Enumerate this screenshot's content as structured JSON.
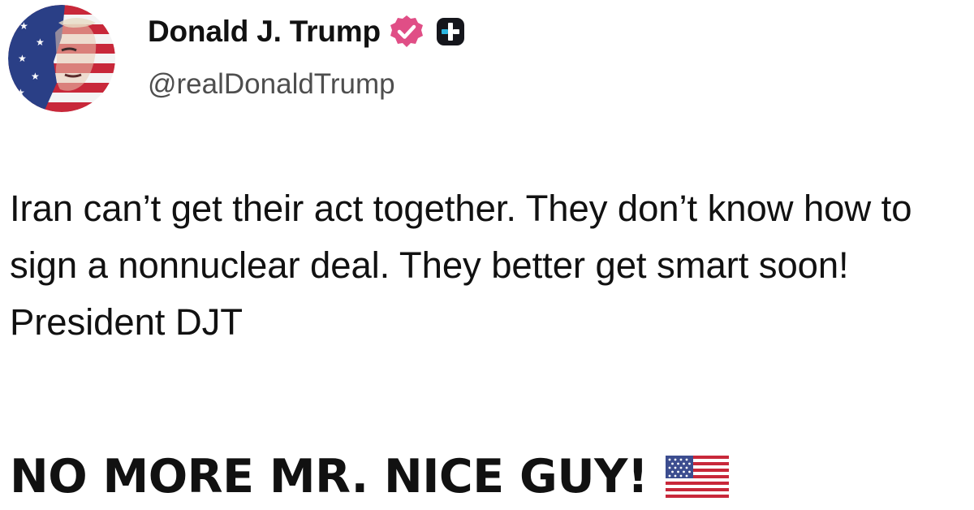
{
  "post": {
    "author": {
      "display_name": "Donald J. Trump",
      "handle": "@realDonaldTrump",
      "verified": true,
      "avatar_icon": "stars-and-stripes-portrait-avatar",
      "badges": [
        "verified-badge-icon",
        "plus-badge-icon"
      ]
    },
    "body": "Iran can’t get their act together. They don’t know how to sign a nonnuclear deal. They better get smart soon! President DJT",
    "slogan": "NO MORE MR. NICE GUY!",
    "slogan_emoji": "us-flag-icon"
  },
  "colors": {
    "verified_badge": "#e04e86",
    "plus_badge": "#15161c",
    "plus_badge_accent": "#2bb5e0",
    "text_primary": "#111111",
    "text_secondary": "#4e4e4e",
    "background": "#ffffff"
  }
}
